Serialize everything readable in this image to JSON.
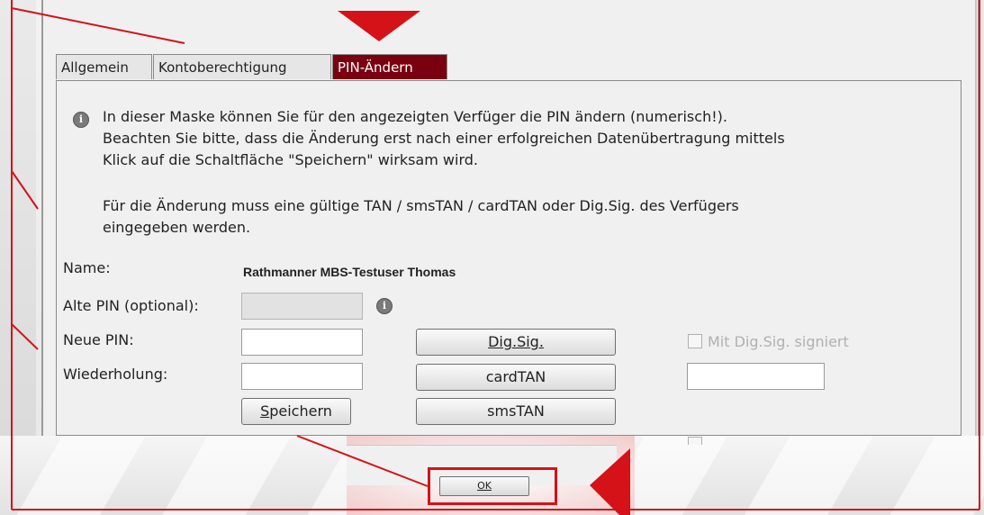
{
  "tabs": [
    {
      "label": "Allgemein"
    },
    {
      "label": "Kontoberechtigung"
    },
    {
      "label": "PIN-Ändern"
    }
  ],
  "info": {
    "lines": [
      "In dieser Maske können Sie für den angezeigten Verfüger die PIN ändern (numerisch!).",
      "Beachten Sie bitte, dass die Änderung erst nach einer erfolgreichen Datenübertragung mittels",
      "Klick auf die Schaltfläche \"Speichern\" wirksam wird.",
      "Für die Änderung muss eine gültige TAN / smsTAN / cardTAN oder Dig.Sig. des Verfügers",
      "eingegeben werden."
    ]
  },
  "form": {
    "name_label": "Name:",
    "name_value": "Rathmanner MBS-Testuser Thomas",
    "old_pin_label": "Alte PIN (optional):",
    "old_pin_value": "",
    "new_pin_label": "Neue PIN:",
    "new_pin_value": "",
    "repeat_label": "Wiederholung:",
    "repeat_value": "",
    "save_label_prefix": "S",
    "save_label_rest": "peichern",
    "digsig_label": "Dig.Sig.",
    "cardtan_label": "cardTAN",
    "smstan_label": "smsTAN",
    "signed_checkbox_label": "Mit Dig.Sig. signiert",
    "signed_checked": false,
    "tan_value": ""
  },
  "ok_button": {
    "label": "OK"
  },
  "colors": {
    "accent_red": "#d41218",
    "active_tab": "#7a0010"
  },
  "icons": {
    "info": "info-icon",
    "pointer_arrow_top": "red-triangle-down-icon",
    "pointer_arrow_ok": "red-triangle-left-icon"
  }
}
